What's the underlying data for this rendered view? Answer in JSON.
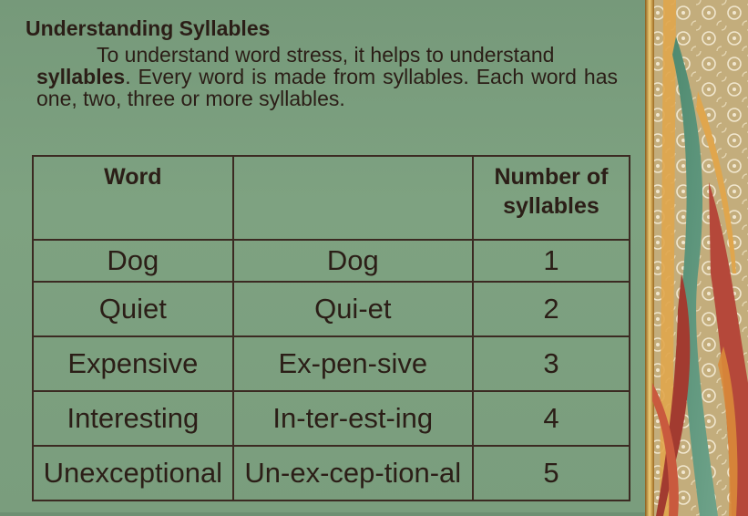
{
  "slide": {
    "title": "Understanding Syllables",
    "intro": {
      "lead": "To understand word stress, it helps to understand",
      "keyword": "syllables",
      "rest": ". Every word is made from syllables. Each word has one, two, three or more syllables."
    }
  },
  "table": {
    "headers": [
      "Word",
      "",
      "Number of syllables"
    ],
    "rows": [
      {
        "word": "Dog",
        "split": "Dog",
        "count": "1"
      },
      {
        "word": "Quiet",
        "split": "Qui-et",
        "count": "2"
      },
      {
        "word": "Expensive",
        "split": "Ex-pen-sive",
        "count": "3"
      },
      {
        "word": "Interesting",
        "split": "In-ter-est-ing",
        "count": "4"
      },
      {
        "word": "Unexceptional",
        "split": "Un-ex-cep-tion-al",
        "count": "5"
      }
    ]
  },
  "colors": {
    "background": "#7b9e7f",
    "text": "#2b1e17",
    "border": "#3b2a22",
    "accent_gold": "#c9a24a",
    "accent_red": "#b5483a"
  }
}
